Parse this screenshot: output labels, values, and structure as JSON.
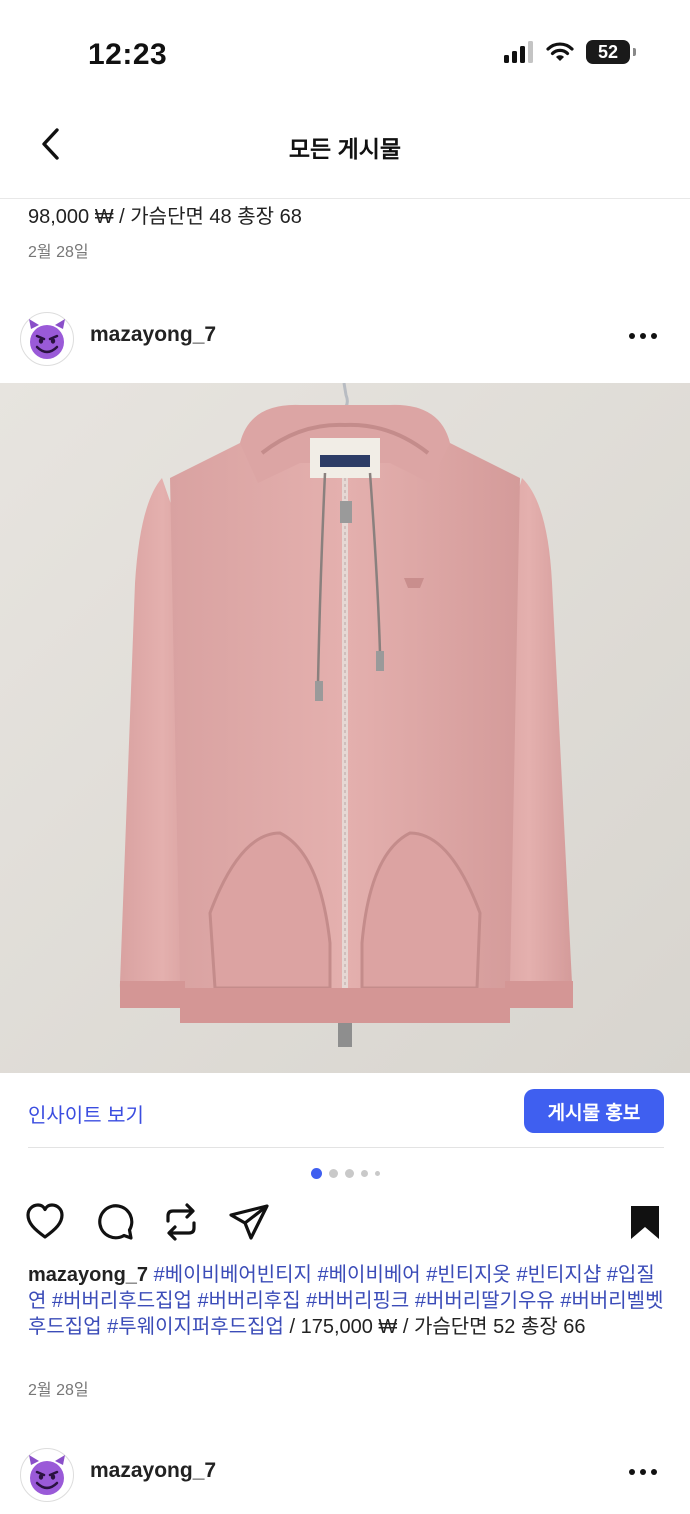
{
  "status": {
    "time": "12:23",
    "battery": "52"
  },
  "nav": {
    "title": "모든 게시물"
  },
  "previous_post": {
    "caption": "98,000 ₩ / 가슴단면 48 총장 68",
    "date": "2월 28일"
  },
  "post": {
    "username": "mazayong_7",
    "insights_label": "인사이트 보기",
    "promote_label": "게시물 홍보",
    "caption_user": "mazayong_7",
    "hashtags": [
      "#베이비베어빈티지",
      "#베이비베어",
      "#빈티지옷",
      "#빈티지샵",
      "#입질연",
      "#버버리후드집업",
      "#버버리후집",
      "#버버리핑크",
      "#버버리딸기우유",
      "#버버리벨벳후드집업",
      "#투웨이지퍼후드집업"
    ],
    "caption_text": "/ 175,000 ₩ / 가슴단면 52 총장 66",
    "date": "2월 28일"
  },
  "next_post": {
    "username": "mazayong_7"
  },
  "colors": {
    "accent": "#3f5ff0",
    "hashtag": "#3b4cb8",
    "link": "#3b4de0"
  }
}
